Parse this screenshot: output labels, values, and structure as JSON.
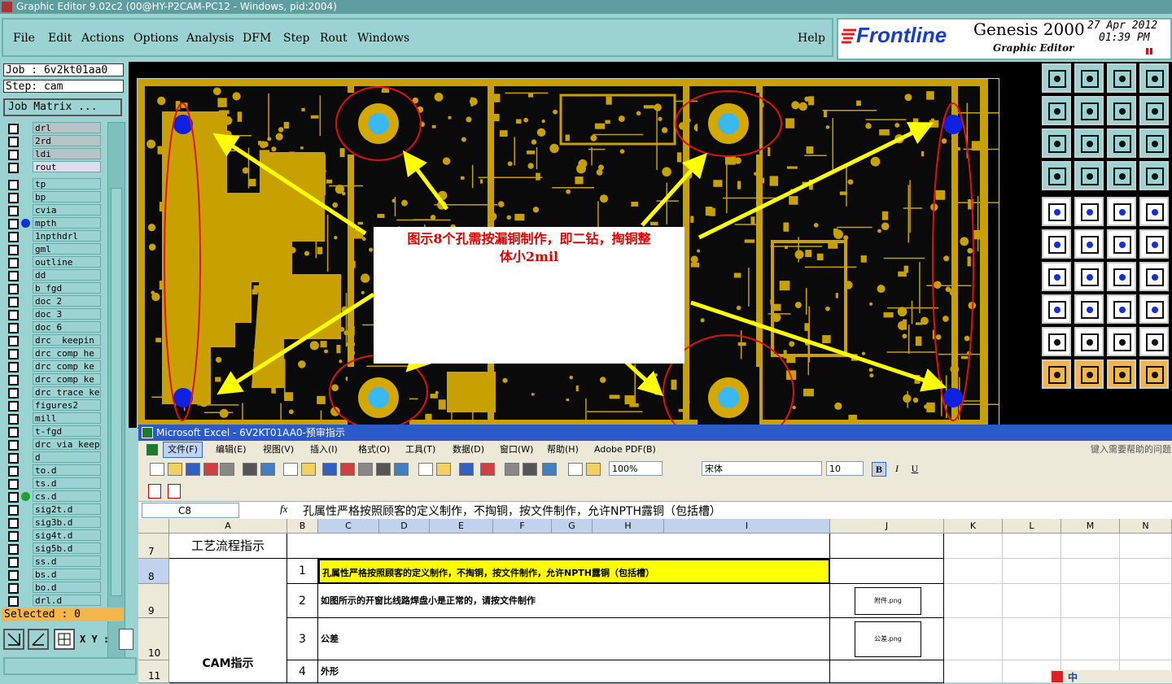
{
  "window": {
    "title": "Graphic Editor 9.02c2 (00@HY-P2CAM-PC12 - Windows, pid:2004)"
  },
  "menu": [
    "File",
    "Edit",
    "Actions",
    "Options",
    "Analysis",
    "DFM",
    "Step",
    "Rout",
    "Windows"
  ],
  "help": "Help",
  "brand": {
    "logo": "Frontline",
    "product": "Genesis 2000",
    "subtitle": "Graphic Editor",
    "date": "27 Apr 2012",
    "time": "01:39 PM"
  },
  "job": {
    "job_label": "Job : 6v2kt01aa0",
    "step_label": "Step: cam",
    "matrix_button": "Job Matrix ..."
  },
  "layers": [
    {
      "name": "drl",
      "type": "drill"
    },
    {
      "name": "2rd",
      "type": "drill"
    },
    {
      "name": "ldi",
      "type": "drill"
    },
    {
      "name": "rout",
      "type": "rout"
    },
    {
      "name": "tp"
    },
    {
      "name": "bp"
    },
    {
      "name": "cvia"
    },
    {
      "name": "mpth",
      "dot": "#1030e0"
    },
    {
      "name": "1npthdrl"
    },
    {
      "name": "gml"
    },
    {
      "name": "outline"
    },
    {
      "name": "dd"
    },
    {
      "name": "b_fgd"
    },
    {
      "name": "doc_2"
    },
    {
      "name": "doc_3"
    },
    {
      "name": "doc_6"
    },
    {
      "name": "drc__keepin"
    },
    {
      "name": "drc_comp_he"
    },
    {
      "name": "drc_comp_ke"
    },
    {
      "name": "drc_comp_ke"
    },
    {
      "name": "drc_trace_ke"
    },
    {
      "name": "figures2"
    },
    {
      "name": "mill"
    },
    {
      "name": "t-fgd"
    },
    {
      "name": "drc_via_keep"
    },
    {
      "name": "d"
    },
    {
      "name": "to.d"
    },
    {
      "name": "ts.d"
    },
    {
      "name": "cs.d",
      "dot": "#20a030"
    },
    {
      "name": "sig2t.d"
    },
    {
      "name": "sig3b.d"
    },
    {
      "name": "sig4t.d"
    },
    {
      "name": "sig5b.d"
    },
    {
      "name": "ss.d"
    },
    {
      "name": "bs.d"
    },
    {
      "name": "bo.d"
    },
    {
      "name": "drl.d"
    }
  ],
  "status": {
    "selected": "Selected : 0",
    "xy_label": "X Y :"
  },
  "canvas": {
    "annotation_line1": "图示8个孔需按漏铜制作，即二钻，掏铜整",
    "annotation_line2": "体小2mil",
    "colors": {
      "copper": "#c8a000",
      "board": "#0a0a0a",
      "hole": "#3ab8f0",
      "pad_ring": "#d4a800",
      "marker": "#1020e0",
      "arrow": "#ffff00",
      "circle": "#e01010"
    }
  },
  "excel": {
    "title": "Microsoft Excel - 6V2KT01AA0-预审指示",
    "menu": [
      "文件(F)",
      "编辑(E)",
      "视图(V)",
      "插入(I)",
      "格式(O)",
      "工具(T)",
      "数据(D)",
      "窗口(W)",
      "帮助(H)",
      "Adobe PDF(B)"
    ],
    "help_placeholder": "键入需要帮助的问题",
    "zoom": "100%",
    "font": "宋体",
    "font_size": "10",
    "name_box": "C8",
    "fx": "fx",
    "formula": "孔属性严格按照顾客的定义制作，不掏铜，按文件制作，允许NPTH露铜（包括槽）",
    "columns": [
      "A",
      "B",
      "C",
      "D",
      "E",
      "F",
      "G",
      "H",
      "I",
      "J",
      "K",
      "L",
      "M",
      "N"
    ],
    "rows": [
      {
        "num": "7",
        "a": "工艺流程指示"
      },
      {
        "num": "8",
        "b": "1",
        "c": "孔属性严格按照顾客的定义制作，不掏铜，按文件制作，允许NPTH露铜（包括槽）"
      },
      {
        "num": "9",
        "b": "2",
        "c": "如图所示的开窗比线路焊盘小是正常的，请按文件制作",
        "thumb": "附件.png"
      },
      {
        "num": "10",
        "b": "3",
        "c": "公差",
        "thumb": "公差.png"
      },
      {
        "num": "11",
        "b": "4",
        "c": "外形"
      }
    ],
    "merged_label": "CAM指示",
    "highlight_color": "#ffff00"
  },
  "tray": {
    "ime": "中"
  }
}
